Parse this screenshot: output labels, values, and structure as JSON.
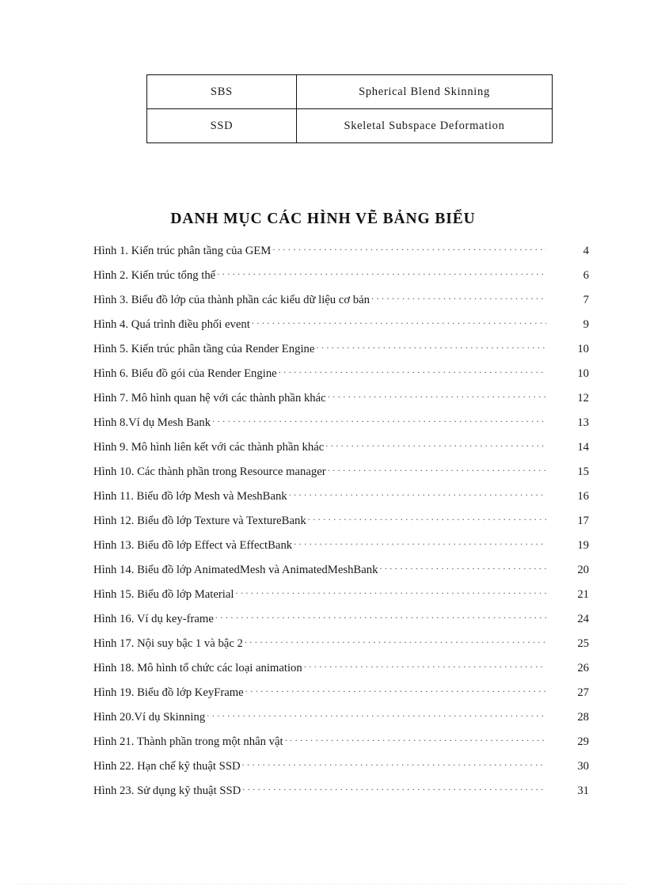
{
  "abbreviation_table": {
    "rows": [
      {
        "code": "SBS",
        "meaning": "Spherical Blend Skinning"
      },
      {
        "code": "SSD",
        "meaning": "Skeletal Subspace Deformation"
      }
    ]
  },
  "list_of_figures": {
    "title": "DANH MỤC CÁC HÌNH VẼ BẢNG BIỂU",
    "entries": [
      {
        "label": "Hình 1. Kiến trúc phân tầng của GEM",
        "page": "4"
      },
      {
        "label": "Hình 2. Kiến trúc tổng thể",
        "page": "6"
      },
      {
        "label": "Hình 3. Biểu đồ lớp của thành phần các kiểu dữ liệu cơ bản",
        "page": "7"
      },
      {
        "label": "Hình 4. Quá trình điều phối event",
        "page": "9"
      },
      {
        "label": "Hình 5. Kiến trúc phân tầng của Render Engine",
        "page": "10"
      },
      {
        "label": "Hình 6. Biểu đồ gói của Render Engine",
        "page": "10"
      },
      {
        "label": "Hình 7. Mô hình quan hệ với các thành phần khác",
        "page": "12"
      },
      {
        "label": "Hình 8.Ví dụ Mesh Bank",
        "page": "13"
      },
      {
        "label": "Hình 9. Mô hình liên kết với các thành phần khác",
        "page": "14"
      },
      {
        "label": "Hình 10. Các thành phần trong Resource manager",
        "page": "15"
      },
      {
        "label": "Hình 11. Biểu đồ lớp Mesh và MeshBank",
        "page": "16"
      },
      {
        "label": "Hình 12. Biểu đồ lớp Texture và TextureBank",
        "page": "17"
      },
      {
        "label": "Hình 13. Biểu đồ lớp Effect và EffectBank",
        "page": "19"
      },
      {
        "label": "Hình 14. Biểu đồ lớp AnimatedMesh và AnimatedMeshBank",
        "page": "20"
      },
      {
        "label": "Hình 15. Biểu đồ lớp Material",
        "page": "21"
      },
      {
        "label": "Hình 16. Ví dụ key-frame",
        "page": "24"
      },
      {
        "label": "Hình 17. Nội suy bậc 1 và bậc 2",
        "page": "25"
      },
      {
        "label": "Hình 18. Mô hình tổ chức các loại animation",
        "page": "26"
      },
      {
        "label": "Hình 19. Biểu đồ lớp KeyFrame",
        "page": "27"
      },
      {
        "label": "Hình 20.Ví dụ Skinning",
        "page": "28"
      },
      {
        "label": "Hình 21. Thành phần trong một nhân vật",
        "page": "29"
      },
      {
        "label": "Hình 22. Hạn chế kỹ thuật SSD",
        "page": "30"
      },
      {
        "label": "Hình 23. Sử dụng kỹ thuật SSD",
        "page": "31"
      }
    ]
  },
  "colors": {
    "page_background": "#ffffff",
    "text": "#1a1a1a",
    "table_border": "#111111",
    "leader_dots": "#4a4a4a"
  }
}
